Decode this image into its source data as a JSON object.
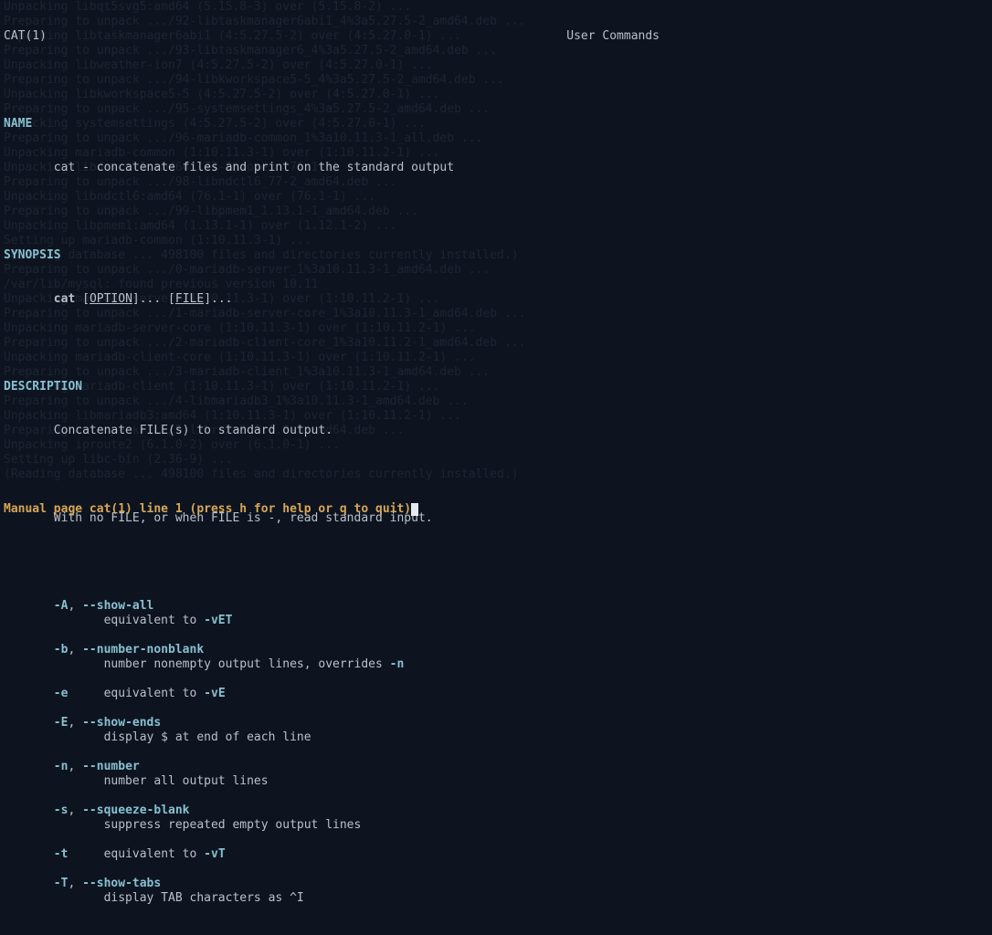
{
  "bg_text": "Unpacking libqt5svg5:amd64 (5.15.8-3) over (5.15.8-2) ...\nPreparing to unpack .../92-libtaskmanager6abi1_4%3a5.27.5-2_amd64.deb ...\nUnpacking libtaskmanager6abi1 (4:5.27.5-2) over (4:5.27.0-1) ...\nPreparing to unpack .../93-libtaskmanager6_4%3a5.27.5-2_amd64.deb ...\nUnpacking libweather-ion7 (4:5.27.5-2) over (4:5.27.0-1) ...\nPreparing to unpack .../94-libkworkspace5-5_4%3a5.27.5-2_amd64.deb ...\nUnpacking libkworkspace5-5 (4:5.27.5-2) over (4:5.27.0-1) ...\nPreparing to unpack .../95-systemsettings_4%3a5.27.5-2_amd64.deb ...\nUnpacking systemsettings (4:5.27.5-2) over (4:5.27.0-1) ...\nPreparing to unpack .../96-mariadb-common_1%3a10.11.3-1_all.deb ...\nUnpacking mariadb-common (1:10.11.3-1) over (1:10.11.2-1) ...\nUnpacking libdaxctl1:amd64 (77-2) over (76.1-1) ...\nPreparing to unpack .../98-libndctl6_77-2_amd64.deb ...\nUnpacking libndctl6:amd64 (76.1-1) over (76.1-1) ...\nPreparing to unpack .../99-libpmem1_1.13.1-1_amd64.deb ...\nUnpacking libpmem1:amd64 (1.13.1-1) over (1.12.1-2) ...\nSetting up mariadb-common (1:10.11.3-1) ...\n(Reading database ... 498100 files and directories currently installed.)\nPreparing to unpack .../0-mariadb-server_1%3a10.11.3-1_amd64.deb ...\n/var/lib/mysql: found previous version 10.11\nUnpacking mariadb-server (1:10.11.3-1) over (1:10.11.2-1) ...\nPreparing to unpack .../1-mariadb-server-core_1%3a10.11.3-1_amd64.deb ...\nUnpacking mariadb-server-core (1:10.11.3-1) over (1:10.11.2-1) ...\nPreparing to unpack .../2-mariadb-client-core_1%3a10.11.2-1_amd64.deb ...\nUnpacking mariadb-client-core (1:10.11.3-1) over (1:10.11.2-1) ...\nPreparing to unpack .../3-mariadb-client_1%3a10.11.3-1_amd64.deb ...\nUnpacking mariadb-client (1:10.11.3-1) over (1:10.11.2-1) ...\nPreparing to unpack .../4-libmariadb3_1%3a10.11.3-1_amd64.deb ...\nUnpacking libmariadb3:amd64 (1:10.11.3-1) over (1:10.11.2-1) ...\nPreparing to unpack .../5-libre2-0_0.1.0-3_amd64.deb ...\nUnpacking iproute2 (6.1.0-2) over (6.1.0-1) ...\nSetting up libc-bin (2.36-9) ...\n(Reading database ... 498100 files and directories currently installed.)",
  "header": {
    "left": "CAT(1)",
    "center": "User Commands"
  },
  "sections": {
    "name_heading": "NAME",
    "name_text": "       cat - concatenate files and print on the standard output",
    "synopsis_heading": "SYNOPSIS",
    "synopsis_indent": "       ",
    "synopsis_cmd": "cat",
    "synopsis_lb1": " [",
    "synopsis_option": "OPTION",
    "synopsis_mid": "]... [",
    "synopsis_file": "FILE",
    "synopsis_end": "]...",
    "description_heading": "DESCRIPTION",
    "desc_line1": "       Concatenate FILE(s) to standard output.",
    "desc_line2": "       With no FILE, or when FILE is -, read standard input.",
    "options": [
      {
        "short": "-A",
        "long": "--show-all",
        "desc": "              equivalent to ",
        "ref": "-vET",
        "tail": ""
      },
      {
        "short": "-b",
        "long": "--number-nonblank",
        "desc": "              number nonempty output lines, overrides ",
        "ref": "-n",
        "tail": ""
      },
      {
        "short": "-e",
        "long": "",
        "desc": "     equivalent to ",
        "ref": "-vE",
        "tail": ""
      },
      {
        "short": "-E",
        "long": "--show-ends",
        "desc": "              display $ at end of each line",
        "ref": "",
        "tail": ""
      },
      {
        "short": "-n",
        "long": "--number",
        "desc": "              number all output lines",
        "ref": "",
        "tail": ""
      },
      {
        "short": "-s",
        "long": "--squeeze-blank",
        "desc": "              suppress repeated empty output lines",
        "ref": "",
        "tail": ""
      },
      {
        "short": "-t",
        "long": "",
        "desc": "     equivalent to ",
        "ref": "-vT",
        "tail": ""
      },
      {
        "short": "-T",
        "long": "--show-tabs",
        "desc": "              display TAB characters as ^I",
        "ref": "",
        "tail": ""
      }
    ]
  },
  "status": " Manual page cat(1) line 1 (press h for help or q to quit)",
  "colors": {
    "heading": "#88c0d0",
    "text": "#bac0ca",
    "status": "#d8a657",
    "bg": "#0d1420"
  }
}
